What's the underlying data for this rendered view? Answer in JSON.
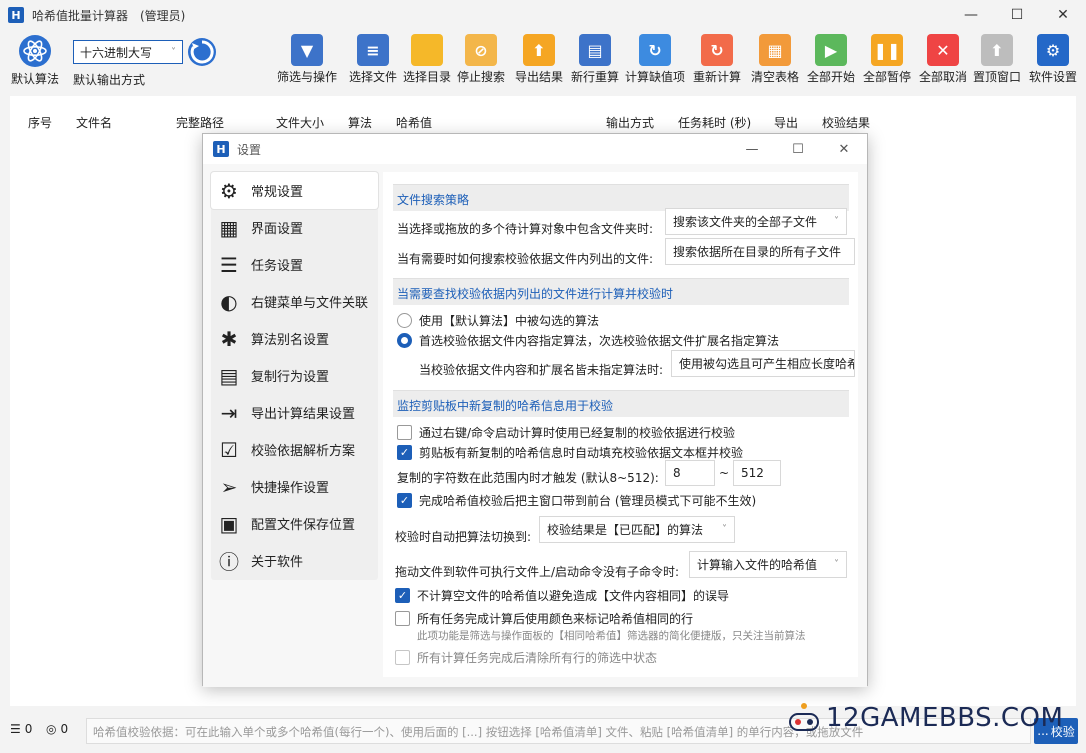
{
  "window": {
    "title": "哈希值批量计算器　(管理员)",
    "logo_letter": "H",
    "minimize": "—",
    "maximize": "☐",
    "close": "✕"
  },
  "toolbar": {
    "default_algo_label": "默认算法",
    "format_select_value": "十六进制大写",
    "format_label": "默认输出方式",
    "buttons": [
      {
        "label": "筛选与操作",
        "color": "#3d73c9",
        "glyph": "▼"
      },
      {
        "label": "选择文件",
        "color": "#3d73c9",
        "glyph": "≡"
      },
      {
        "label": "选择目录",
        "color": "#f5b829",
        "glyph": ""
      },
      {
        "label": "停止搜索",
        "color": "#f3b64a",
        "glyph": "⊘"
      },
      {
        "label": "导出结果",
        "color": "#f5a623",
        "glyph": "⬆"
      },
      {
        "label": "新行重算",
        "color": "#3d73c9",
        "glyph": "▤"
      },
      {
        "label": "计算缺值项",
        "color": "#3d8be0",
        "glyph": "↻"
      },
      {
        "label": "重新计算",
        "color": "#f26b4a",
        "glyph": "↻"
      },
      {
        "label": "清空表格",
        "color": "#f29a3a",
        "glyph": "▦"
      },
      {
        "label": "全部开始",
        "color": "#5cb85c",
        "glyph": "▶"
      },
      {
        "label": "全部暂停",
        "color": "#f5a623",
        "glyph": "❚❚"
      },
      {
        "label": "全部取消",
        "color": "#ef4444",
        "glyph": "✕"
      },
      {
        "label": "置顶窗口",
        "color": "#bdbdbd",
        "glyph": "⬆"
      },
      {
        "label": "软件设置",
        "color": "#2468c8",
        "glyph": "⚙"
      }
    ]
  },
  "table": {
    "columns": [
      "序号",
      "文件名",
      "完整路径",
      "文件大小",
      "算法",
      "哈希值",
      "输出方式",
      "任务耗时 (秒)",
      "导出",
      "校验结果"
    ]
  },
  "statusbar": {
    "count_a": "0",
    "count_b": "0",
    "hash_placeholder": "哈希值校验依据：可在此输入单个或多个哈希值(每行一个)、使用后面的 [...] 按钮选择 [哈希值清单] 文件、粘贴 [哈希值清单] 的单行内容，或拖放文件",
    "more_button": "...",
    "verify_button": "校验"
  },
  "watermark": {
    "text": "12GAMEBBS.COM"
  },
  "dialog": {
    "title": "设置",
    "nav": [
      {
        "label": "常规设置",
        "icon": "gear-icon",
        "active": true
      },
      {
        "label": "界面设置",
        "icon": "window-layout-icon"
      },
      {
        "label": "任务设置",
        "icon": "clipboard-list-icon"
      },
      {
        "label": "右键菜单与文件关联",
        "icon": "mouse-icon"
      },
      {
        "label": "算法别名设置",
        "icon": "atom-icon"
      },
      {
        "label": "复制行为设置",
        "icon": "copy-document-icon"
      },
      {
        "label": "导出计算结果设置",
        "icon": "export-arrow-icon"
      },
      {
        "label": "校验依据解析方案",
        "icon": "checklist-icon"
      },
      {
        "label": "快捷操作设置",
        "icon": "paper-plane-icon"
      },
      {
        "label": "配置文件保存位置",
        "icon": "config-file-icon"
      },
      {
        "label": "关于软件",
        "icon": "info-icon"
      }
    ],
    "sec1": {
      "head": "文件搜索策略",
      "row1_label": "当选择或拖放的多个待计算对象中包含文件夹时:",
      "row1_value": "搜索该文件夹的全部子文件",
      "row2_label": "当有需要时如何搜索校验依据文件内列出的文件:",
      "row2_value": "搜索依据所在目录的所有子文件"
    },
    "sec2": {
      "head": "当需要查找校验依据内列出的文件进行计算并校验时",
      "radio1": "使用【默认算法】中被勾选的算法",
      "radio2": "首选校验依据文件内容指定算法，次选校验依据文件扩展名指定算法",
      "sub_label": "当校验依据文件内容和扩展名皆未指定算法时:",
      "sub_value": "使用被勾选且可产生相应长度哈希值"
    },
    "sec3": {
      "head": "监控剪贴板中新复制的哈希信息用于校验",
      "cb1": "通过右键/命令启动计算时使用已经复制的校验依据进行校验",
      "cb2": "剪贴板有新复制的哈希信息时自动填充校验依据文本框并校验",
      "range_label": "复制的字符数在此范围内时才触发 (默认8~512):",
      "range_min": "8",
      "range_sep": "~",
      "range_max": "512",
      "cb3": "完成哈希值校验后把主窗口带到前台 (管理员模式下可能不生效)"
    },
    "misc": {
      "algo_switch_label": "校验时自动把算法切换到:",
      "algo_switch_value": "校验结果是【已匹配】的算法",
      "drag_label": "拖动文件到软件可执行文件上/启动命令没有子命令时:",
      "drag_value": "计算输入文件的哈希值",
      "cb_empty": "不计算空文件的哈希值以避免造成【文件内容相同】的误导",
      "cb_color": "所有任务完成计算后使用颜色来标记哈希值相同的行",
      "note_color": "此项功能是筛选与操作面板的【相同哈希值】筛选器的简化便捷版，只关注当前算法",
      "cb_clear": "所有计算任务完成后清除所有行的筛选中状态"
    }
  }
}
